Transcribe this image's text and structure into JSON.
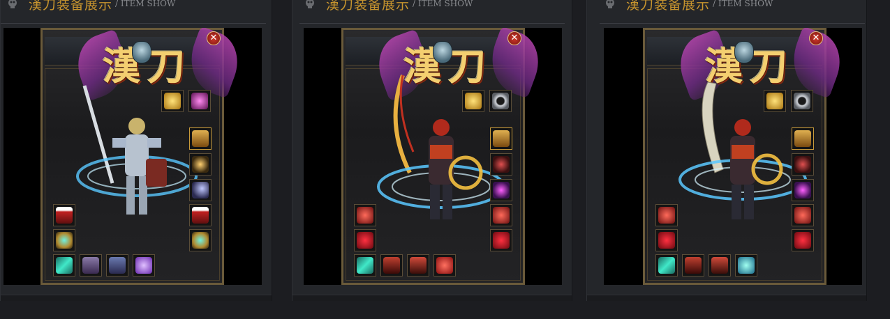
{
  "page": {
    "background": "#1c1d21",
    "accent_title": "#c8952e"
  },
  "panels": [
    {
      "header_title": "漢刀装备展示",
      "header_sub": "/ ITEM SHOW",
      "logo_text": "漢刀",
      "close_glyph": "✕",
      "character": "silver-armored-warrior",
      "slots_top": [
        "gold-medal-icon",
        "pink-gem-icon"
      ],
      "slots_right": [
        "treasure-chest-icon",
        "amulet-icon",
        "moon-talisman-icon",
        "claw-gauntlet-icon",
        "jeweled-ring-icon"
      ],
      "slots_left": [
        "claw-gauntlet-icon",
        "jeweled-ring-icon"
      ],
      "slots_bottom": [
        "jade-sword-icon",
        "armored-boots-icon",
        "armor-belt-icon",
        "purple-crystal-icon"
      ]
    },
    {
      "header_title": "漢刀装备展示",
      "header_sub": "/ ITEM SHOW",
      "logo_text": "漢刀",
      "close_glyph": "✕",
      "character": "crimson-demon-warrior",
      "slots_top": [
        "gold-medal-icon",
        "silver-ring-icon"
      ],
      "slots_right": [
        "treasure-chest-icon",
        "red-amulet-icon",
        "violet-talisman-icon",
        "red-gauntlet-icon",
        "ruby-ring-icon"
      ],
      "slots_left": [
        "red-gauntlet-icon",
        "ruby-ring-icon"
      ],
      "slots_bottom": [
        "jade-sword-icon",
        "red-boots-icon",
        "red-belt-icon",
        "ruby-gem-icon"
      ]
    },
    {
      "header_title": "漢刀装备展示",
      "header_sub": "/ ITEM SHOW",
      "logo_text": "漢刀",
      "close_glyph": "✕",
      "character": "crimson-demon-warrior-greatsword",
      "slots_top": [
        "gold-medal-icon",
        "silver-ring-icon"
      ],
      "slots_right": [
        "treasure-chest-icon",
        "red-amulet-icon",
        "violet-talisman-icon",
        "red-gauntlet-icon",
        "ruby-ring-icon"
      ],
      "slots_left": [
        "red-gauntlet-icon",
        "ruby-ring-icon"
      ],
      "slots_bottom": [
        "jade-sword-icon",
        "red-boots-icon",
        "red-belt-icon",
        "cyan-orb-icon"
      ]
    }
  ]
}
